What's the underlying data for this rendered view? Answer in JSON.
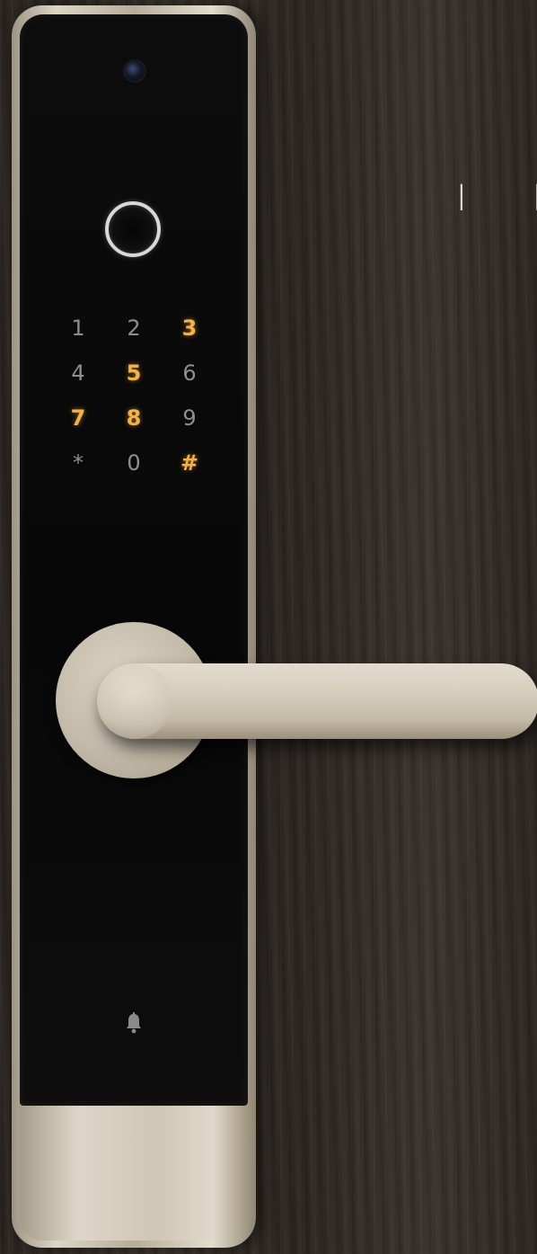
{
  "heading": {
    "text": "I N"
  },
  "keypad": {
    "keys": [
      {
        "label": "1",
        "lit": false
      },
      {
        "label": "2",
        "lit": false
      },
      {
        "label": "3",
        "lit": true
      },
      {
        "label": "4",
        "lit": false
      },
      {
        "label": "5",
        "lit": true
      },
      {
        "label": "6",
        "lit": false
      },
      {
        "label": "7",
        "lit": true
      },
      {
        "label": "8",
        "lit": true
      },
      {
        "label": "9",
        "lit": false
      },
      {
        "label": "*",
        "lit": false
      },
      {
        "label": "0",
        "lit": false
      },
      {
        "label": "#",
        "lit": true
      }
    ],
    "lit_color": "#f3b248",
    "unlit_color": "#8f8f8f"
  },
  "icons": {
    "camera": "camera-icon",
    "fingerprint": "fingerprint-sensor-icon",
    "doorbell": "bell-icon"
  },
  "colors": {
    "panel": "#0a0a0a",
    "metal": "#cfc6b5",
    "door": "#2e2824"
  }
}
